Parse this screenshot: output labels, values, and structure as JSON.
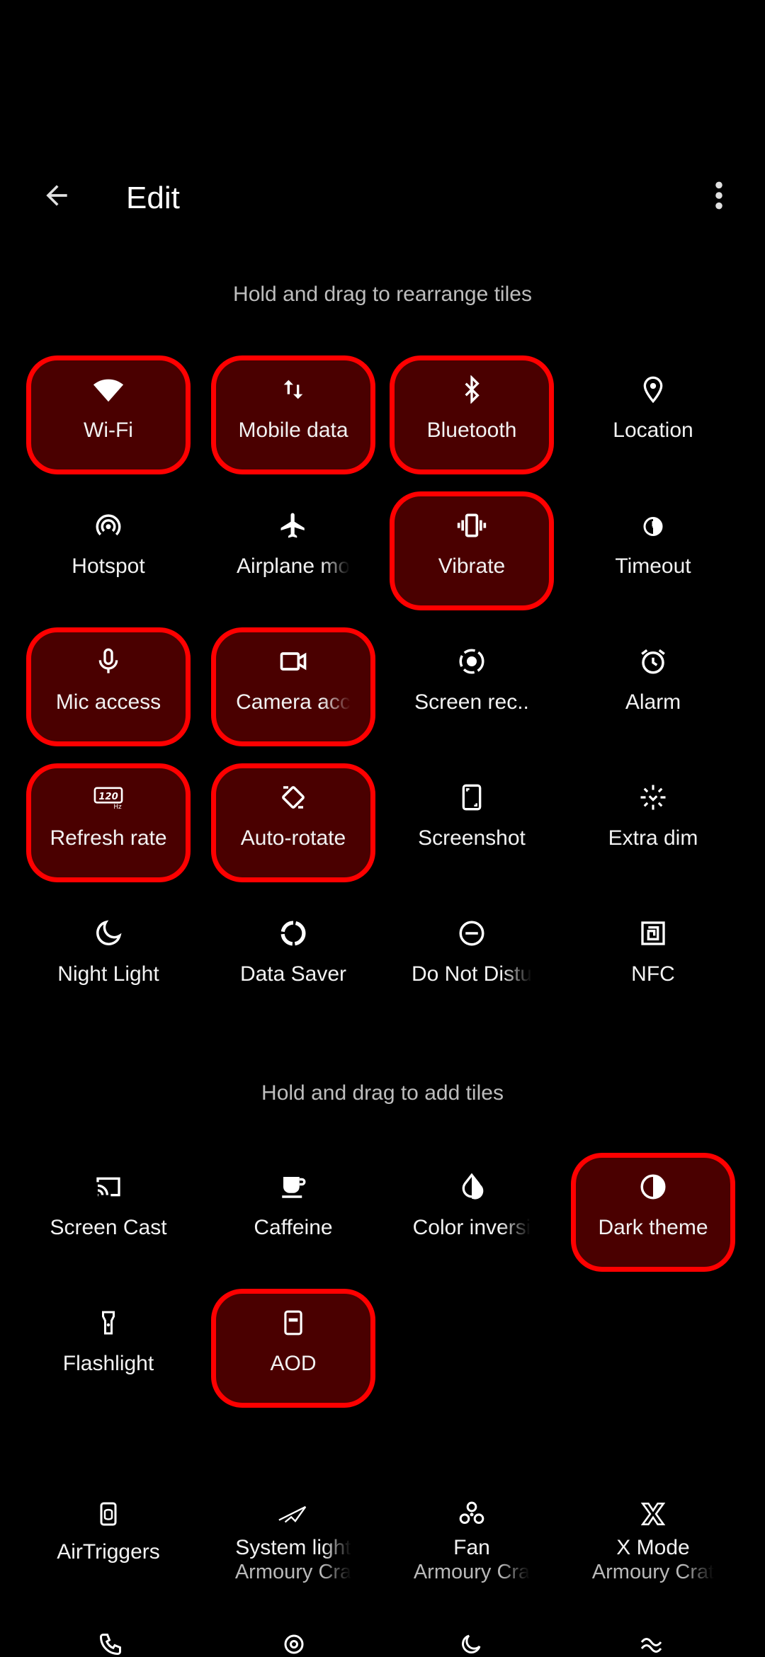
{
  "header": {
    "title": "Edit"
  },
  "labels": {
    "rearrange": "Hold and drag to rearrange tiles",
    "add": "Hold and drag to add tiles"
  },
  "active_tiles": [
    {
      "label": "Wi-Fi",
      "icon": "wifi-icon",
      "enabled": true
    },
    {
      "label": "Mobile data",
      "icon": "mobile-data-icon",
      "enabled": true
    },
    {
      "label": "Bluetooth",
      "icon": "bluetooth-icon",
      "enabled": true
    },
    {
      "label": "Location",
      "icon": "location-icon",
      "enabled": false
    },
    {
      "label": "Hotspot",
      "icon": "hotspot-icon",
      "enabled": false
    },
    {
      "label": "Airplane mo",
      "icon": "airplane-icon",
      "enabled": false
    },
    {
      "label": "Vibrate",
      "icon": "vibrate-icon",
      "enabled": true
    },
    {
      "label": "Timeout",
      "icon": "timeout-icon",
      "enabled": false
    },
    {
      "label": "Mic access",
      "icon": "mic-icon",
      "enabled": true
    },
    {
      "label": "Camera acc",
      "icon": "camera-icon",
      "enabled": true
    },
    {
      "label": "Screen rec..",
      "icon": "screen-record-icon",
      "enabled": false
    },
    {
      "label": "Alarm",
      "icon": "alarm-icon",
      "enabled": false
    },
    {
      "label": "Refresh rate",
      "icon": "refresh-rate-icon",
      "enabled": true
    },
    {
      "label": "Auto-rotate",
      "icon": "auto-rotate-icon",
      "enabled": true
    },
    {
      "label": "Screenshot",
      "icon": "screenshot-icon",
      "enabled": false
    },
    {
      "label": "Extra dim",
      "icon": "extra-dim-icon",
      "enabled": false
    },
    {
      "label": "Night Light",
      "icon": "night-light-icon",
      "enabled": false
    },
    {
      "label": "Data Saver",
      "icon": "data-saver-icon",
      "enabled": false
    },
    {
      "label": "Do Not Distu",
      "icon": "do-not-disturb-icon",
      "enabled": false
    },
    {
      "label": "NFC",
      "icon": "nfc-icon",
      "enabled": false
    }
  ],
  "available_tiles": [
    {
      "label": "Screen Cast",
      "icon": "screen-cast-icon",
      "enabled": false
    },
    {
      "label": "Caffeine",
      "icon": "caffeine-icon",
      "enabled": false
    },
    {
      "label": "Color inversi",
      "icon": "color-inversion-icon",
      "enabled": false
    },
    {
      "label": "Dark theme",
      "icon": "dark-theme-icon",
      "enabled": true
    },
    {
      "label": "Flashlight",
      "icon": "flashlight-icon",
      "enabled": false
    },
    {
      "label": "AOD",
      "icon": "aod-icon",
      "enabled": true
    }
  ],
  "app_tiles": [
    {
      "label": "AirTriggers",
      "sub": "",
      "icon": "airtriggers-icon"
    },
    {
      "label": "System light",
      "sub": "Armoury Cra",
      "icon": "rog-icon"
    },
    {
      "label": "Fan",
      "sub": "Armoury Cra",
      "icon": "fan-icon"
    },
    {
      "label": "X Mode",
      "sub": "Armoury Crat",
      "icon": "x-mode-icon"
    }
  ],
  "colors": {
    "active_fill": "#4a0000",
    "active_border": "#ff0000",
    "background": "#000000"
  }
}
